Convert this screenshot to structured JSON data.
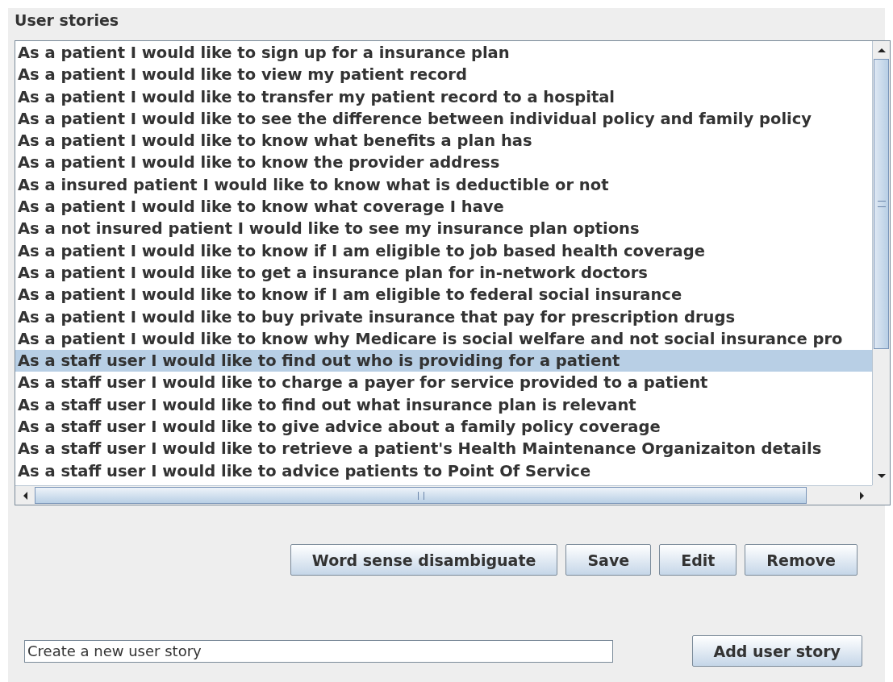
{
  "panel": {
    "title": "User stories"
  },
  "stories": [
    {
      "text": "As a patient I would like to sign up for a insurance plan",
      "selected": false
    },
    {
      "text": "As a patient I would like to view my patient record",
      "selected": false
    },
    {
      "text": "As a patient I would like to transfer my patient record to a hospital",
      "selected": false
    },
    {
      "text": "As a patient I would like to see the difference between individual policy and family policy",
      "selected": false
    },
    {
      "text": "As a patient I would like to know what benefits a plan has",
      "selected": false
    },
    {
      "text": "As a patient I would like to know the provider address",
      "selected": false
    },
    {
      "text": "As a insured patient I would like to know what is deductible or not",
      "selected": false
    },
    {
      "text": "As a patient I would like to know what coverage I have",
      "selected": false
    },
    {
      "text": "As a not insured patient I would like to see my insurance plan options",
      "selected": false
    },
    {
      "text": "As a patient I would like to know if I am eligible to job based health coverage",
      "selected": false
    },
    {
      "text": "As a patient I would like to get a insurance plan for in-network doctors",
      "selected": false
    },
    {
      "text": "As a patient I would like to know if I am eligible to federal social insurance",
      "selected": false
    },
    {
      "text": "As a patient I would like to buy private insurance that pay for prescription drugs",
      "selected": false
    },
    {
      "text": "As a patient I would like to know why Medicare is social welfare and not social insurance pro",
      "selected": false
    },
    {
      "text": "As a staff user I would like to find out who is providing for a patient",
      "selected": true
    },
    {
      "text": "As a staff user I would like to charge a payer for service provided to a patient",
      "selected": false
    },
    {
      "text": "As a staff user I would like to find out what insurance plan is relevant",
      "selected": false
    },
    {
      "text": "As a staff user I would like to give advice about a family policy coverage",
      "selected": false
    },
    {
      "text": "As a staff user I would like to retrieve a patient's Health Maintenance Organizaiton details",
      "selected": false
    },
    {
      "text": "As a staff user I would like to advice patients to Point Of Service",
      "selected": false
    }
  ],
  "actions": [
    "Word sense disambiguate",
    "Save",
    "Edit",
    "Remove"
  ],
  "new_story": {
    "value": "Create a new user story",
    "button": "Add user story"
  }
}
